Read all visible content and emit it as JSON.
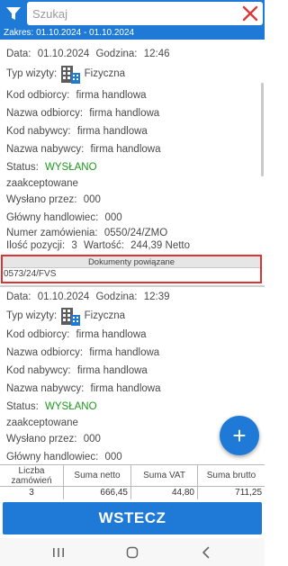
{
  "search": {
    "placeholder": "Szukaj",
    "value": ""
  },
  "range": {
    "label": "Zakres: 01.10.2024 - 01.10.2024"
  },
  "visits": [
    {
      "date_label": "Data:",
      "date": "01.10.2024",
      "time_label": "Godzina:",
      "time": "12:46",
      "type_label": "Typ wizyty:",
      "type": "Fizyczna",
      "recipient_code_label": "Kod odbiorcy:",
      "recipient_code": "firma handlowa",
      "recipient_name_label": "Nazwa odbiorcy:",
      "recipient_name": "firma handlowa",
      "buyer_code_label": "Kod nabywcy:",
      "buyer_code": "firma handlowa",
      "buyer_name_label": "Nazwa nabywcy:",
      "buyer_name": "firma handlowa",
      "status_label": "Status:",
      "status": "WYSŁANO",
      "status_note": "zaakceptowane",
      "sent_by_label": "Wysłano przez:",
      "sent_by": "000",
      "main_trader_label": "Główny handlowiec:",
      "main_trader": "000",
      "order_no_label": "Numer zamówienia:",
      "order_no": "0550/24/ZMO",
      "items_label": "Ilość pozycji:",
      "items": "3",
      "value_label": "Wartość:",
      "value": "244,39 Netto",
      "docs_header": "Dokumenty powiązane",
      "docs_value": "0573/24/FVS"
    },
    {
      "date_label": "Data:",
      "date": "01.10.2024",
      "time_label": "Godzina:",
      "time": "12:39",
      "type_label": "Typ wizyty:",
      "type": "Fizyczna",
      "recipient_code_label": "Kod odbiorcy:",
      "recipient_code": "firma handlowa",
      "recipient_name_label": "Nazwa odbiorcy:",
      "recipient_name": "firma handlowa",
      "buyer_code_label": "Kod nabywcy:",
      "buyer_code": "firma handlowa",
      "buyer_name_label": "Nazwa nabywcy:",
      "buyer_name": "firma handlowa",
      "status_label": "Status:",
      "status": "WYSŁANO",
      "status_note": "zaakceptowane",
      "sent_by_label": "Wysłano przez:",
      "sent_by": "000",
      "main_trader_label": "Główny handlowiec:",
      "main_trader": "000"
    }
  ],
  "summary": {
    "headers": [
      "Liczba zamówień",
      "Suma netto",
      "Suma VAT",
      "Suma brutto"
    ],
    "values": [
      "3",
      "666,45",
      "44,80",
      "711,25"
    ]
  },
  "back_label": "WSTECZ",
  "fab_label": "+",
  "icons": {
    "filter": "filter-icon",
    "clear": "close-icon",
    "building": "building-icon",
    "recent": "recent-apps-icon",
    "home": "home-icon",
    "back": "back-icon"
  },
  "colors": {
    "accent": "#1e7ad6",
    "status_ok": "#1a9a1a",
    "highlight_border": "#dd3333"
  }
}
